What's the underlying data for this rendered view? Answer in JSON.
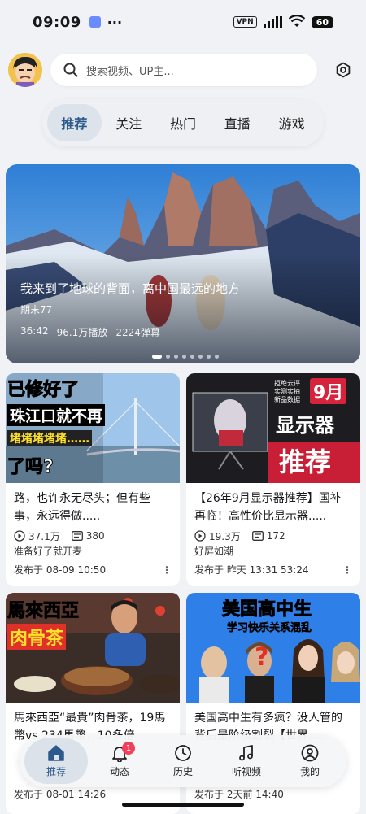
{
  "status_bar": {
    "time": "09:09",
    "vpn": "VPN",
    "battery": "60"
  },
  "search": {
    "placeholder": "搜索视频、UP主..."
  },
  "tabs": [
    "推荐",
    "关注",
    "热门",
    "直播",
    "游戏"
  ],
  "banner": {
    "title": "我来到了地球的背面，离中国最远的地方",
    "author": "期末77",
    "duration": "36:42",
    "views": "96.1万播放",
    "danmaku": "2224弹幕",
    "slide_count": 8,
    "active_slide": 1
  },
  "cards": [
    {
      "thumb_lines": [
        "已修好了",
        "珠江口就不再",
        "堵堵堵堵堵……",
        "了吗?"
      ],
      "title": "路，也许永无尽头；但有些事，永远得做.....",
      "views": "37.1万",
      "danmaku": "380",
      "up": "准备好了就开麦",
      "published": "发布于 08-09  10:50"
    },
    {
      "thumb_lines": [
        "拒绝云评",
        "实测实拍",
        "新品数据",
        "9月",
        "显示器",
        "推荐"
      ],
      "title": "【26年9月显示器推荐】国补再临！高性价比显示器.....",
      "views": "19.3万",
      "danmaku": "172",
      "up": "好屏如潮",
      "published": "发布于 昨天 13:31  53:24"
    },
    {
      "thumb_lines": [
        "馬來西亞",
        "肉骨茶"
      ],
      "title": "馬來西亞“最貴”肉骨茶，19馬幣vs 234馬幣，10多倍",
      "published": "发布于 08-01  14:26"
    },
    {
      "thumb_lines": [
        "美国高中生",
        "学习快乐关系混乱"
      ],
      "title": "美国高中生有多疯？没人管的背后是阶级割裂【世界.....",
      "published": "发布于 2天前  14:40"
    }
  ],
  "bottom_nav": [
    {
      "label": "推荐",
      "icon": "home-icon",
      "active": true
    },
    {
      "label": "动态",
      "icon": "bell-icon",
      "badge": "1"
    },
    {
      "label": "历史",
      "icon": "clock-icon"
    },
    {
      "label": "听视频",
      "icon": "music-note-icon"
    },
    {
      "label": "我的",
      "icon": "user-icon"
    }
  ]
}
